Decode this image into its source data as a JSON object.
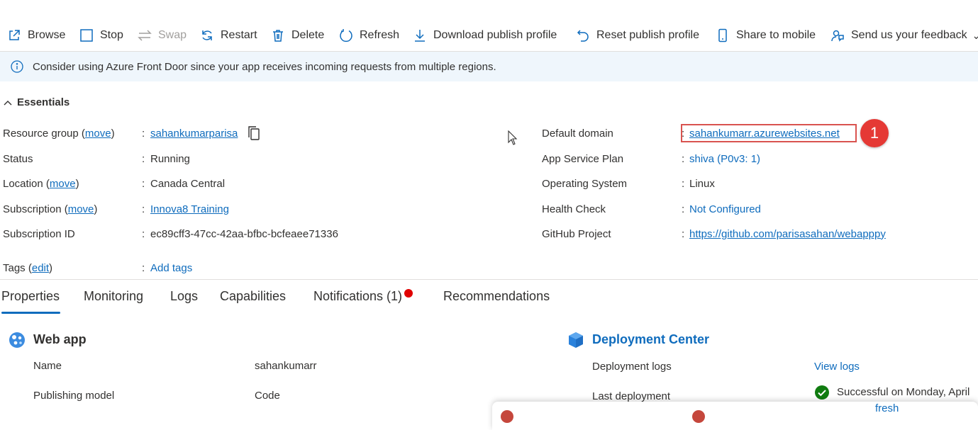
{
  "toolbar": {
    "browse": "Browse",
    "stop": "Stop",
    "swap": "Swap",
    "restart": "Restart",
    "delete": "Delete",
    "refresh": "Refresh",
    "download_publish_profile": "Download publish profile",
    "reset_publish_profile": "Reset publish profile",
    "share_to_mobile": "Share to mobile",
    "send_feedback": "Send us your feedback"
  },
  "banner": {
    "text": "Consider using Azure Front Door since your app receives incoming requests from multiple regions."
  },
  "essentials": {
    "title": "Essentials",
    "left": {
      "resource_group_label": "Resource group",
      "resource_group_move": "move",
      "resource_group_value": "sahankumarparisa",
      "status_label": "Status",
      "status_value": "Running",
      "location_label": "Location",
      "location_move": "move",
      "location_value": "Canada Central",
      "subscription_label": "Subscription",
      "subscription_move": "move",
      "subscription_value": "Innova8 Training",
      "subscription_id_label": "Subscription ID",
      "subscription_id_value": "ec89cff3-47cc-42aa-bfbc-bcfeaee71336",
      "tags_label": "Tags",
      "tags_edit": "edit",
      "tags_value": "Add tags"
    },
    "right": {
      "default_domain_label": "Default domain",
      "default_domain_value": "sahankumarr.azurewebsites.net",
      "app_service_plan_label": "App Service Plan",
      "app_service_plan_value": "shiva (P0v3: 1)",
      "os_label": "Operating System",
      "os_value": "Linux",
      "health_check_label": "Health Check",
      "health_check_value": "Not Configured",
      "github_label": "GitHub Project",
      "github_value": "https://github.com/parisasahan/webapppy"
    },
    "annotation_number": "1",
    "separator": ":"
  },
  "tabs": {
    "properties": "Properties",
    "monitoring": "Monitoring",
    "logs": "Logs",
    "capabilities": "Capabilities",
    "notifications": "Notifications (1)",
    "recommendations": "Recommendations"
  },
  "webapp": {
    "title": "Web app",
    "name_label": "Name",
    "name_value": "sahankumarr",
    "publishing_label": "Publishing model",
    "publishing_value": "Code"
  },
  "deployment": {
    "title": "Deployment Center",
    "logs_label": "Deployment logs",
    "logs_link": "View logs",
    "last_label": "Last deployment",
    "last_value": "Successful on Monday, April",
    "refresh_fragment": "fresh"
  },
  "colors": {
    "accent": "#0f6cbd",
    "banner_bg": "#eff6fc",
    "highlight_border": "#d9534f",
    "badge": "#e53935",
    "notification_dot": "#e00000",
    "success": "#107c10"
  }
}
